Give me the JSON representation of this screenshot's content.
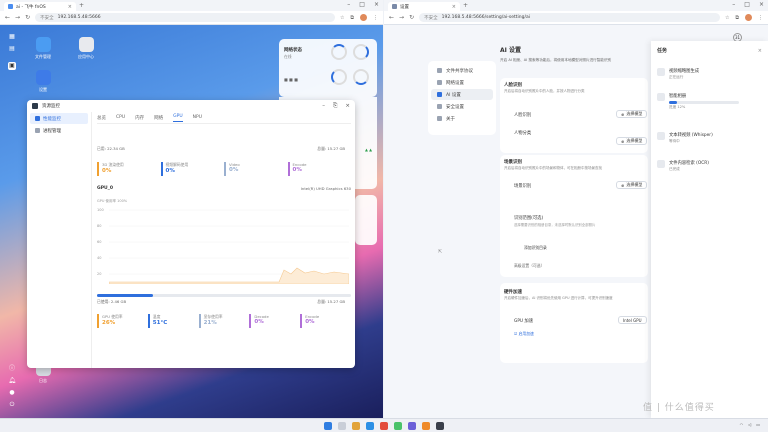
{
  "left_browser": {
    "tab_title": "ai - 飞牛 fnOS",
    "url_prefix": "不安全",
    "url": "192.168.5.48:5666"
  },
  "right_browser": {
    "tab_title": "设置",
    "url_prefix": "不安全",
    "url": "192.168.5.48:5666/setting/ai-setting/ai"
  },
  "desktop": {
    "icons": [
      {
        "label": "文件管理",
        "color": "#4b9cf2"
      },
      {
        "label": "应用中心",
        "color": "#e8eaee"
      },
      {
        "label": "设置",
        "color": "#3e7be8"
      }
    ],
    "bottom_icon_label": "日志",
    "widget_top": {
      "title": "网络状态",
      "sub": "在线",
      "gauges": [
        "CPU",
        "内存"
      ]
    },
    "widget_mid": {
      "title": "系统信息",
      "sub": "已运行 6 天"
    }
  },
  "resource_monitor": {
    "title": "资源监控",
    "sidebar": [
      "性能监控",
      "进程管理"
    ],
    "tabs": [
      "总览",
      "CPU",
      "内存",
      "网络",
      "GPU",
      "NPU"
    ],
    "active_tab": "GPU",
    "mem_line": {
      "left": "已用: 22.34 GB",
      "right": "总量: 15.27 GB"
    },
    "stats": [
      {
        "label": "3D 渲染使用",
        "value": "0%",
        "color": "#f0a030"
      },
      {
        "label": "视频解码使用",
        "value": "0%",
        "color": "#2f6fdd"
      },
      {
        "label": "Video",
        "value": "0%",
        "color": "#9ab0d0"
      },
      {
        "label": "Encode",
        "value": "0%",
        "color": "#b06fd8"
      }
    ],
    "gpu_name": "GPU_0",
    "gpu_model": "Intel(R) UHD Graphics 630",
    "chart_title": "GPU 使用率 100%",
    "y_ticks": [
      "100",
      "80",
      "60",
      "40",
      "20"
    ],
    "mem_bar": {
      "left": "已使用: 2.46 GB",
      "right": "总量: 15.27 GB",
      "fraction": 0.22
    },
    "bottom_stats": [
      {
        "label": "GPU 使用率",
        "value": "26%",
        "color": "#f0a030"
      },
      {
        "label": "温度",
        "value": "51°C",
        "color": "#2f6fdd"
      },
      {
        "label": "显存使用率",
        "value": "21%",
        "color": "#9ab0d0"
      },
      {
        "label": "Decode",
        "value": "0%",
        "color": "#b06fd8"
      },
      {
        "label": "Encode",
        "value": "0%",
        "color": "#b06fd8"
      }
    ]
  },
  "settings": {
    "menu": [
      "文件共享协议",
      "网络设置",
      "AI 设置",
      "安全设置",
      "关于"
    ],
    "active_menu": "AI 设置",
    "heading": "AI 设置",
    "intro": "开启 AI 相册、AI 搜索等功能后，将使用本地模型对照片进行智能识别",
    "sec1": {
      "title": "人脸识别",
      "desc": "开启后将自动识别照片中的人脸，并按人物进行分类",
      "rows": [
        {
          "label": "人脸识别",
          "btn": "选择模型"
        },
        {
          "label": "人物分类",
          "btn": "选择模型"
        }
      ]
    },
    "sec2": {
      "title": "场景识别",
      "desc": "开启后将自动识别照片中的场景和物体，可在相册中按场景查找",
      "rows": [
        {
          "label": "场景识别",
          "btn": "选择模型"
        }
      ],
      "sub_title": "识别范围(可选)",
      "sub_desc": "选择需要识别的相册目录，未选择时默认识别全部照片",
      "link": "添加识别目录",
      "row2": "高级设置（可选）"
    },
    "sec3": {
      "title": "硬件加速",
      "desc": "开启硬件加速后，AI 识别将优先使用 GPU 进行计算，可提升识别速度",
      "row_label": "GPU 加速",
      "row_value": "Intel GPU",
      "check": "启用加速"
    }
  },
  "side_panel": {
    "title": "任务",
    "items": [
      {
        "name": "视频缩略图生成",
        "sub": "正在运行"
      },
      {
        "name": "智能相册",
        "sub": "进度 12%"
      },
      {
        "name": "文本转视频 (Whisper)",
        "sub": "等待中"
      },
      {
        "name": "文件内容检索 (OCR)",
        "sub": "已完成"
      }
    ]
  },
  "watermark": "值 | 什么值得买"
}
